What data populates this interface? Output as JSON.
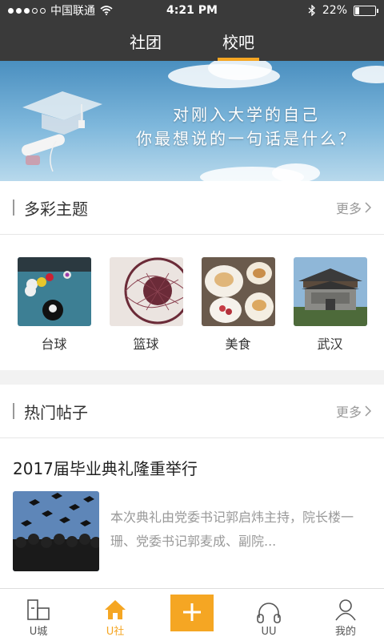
{
  "status_bar": {
    "carrier": "中国联通",
    "time": "4:21 PM",
    "battery": "22%",
    "battery_level": 0.22
  },
  "header": {
    "tabs": [
      {
        "label": "社团",
        "active": false
      },
      {
        "label": "校吧",
        "active": true
      }
    ]
  },
  "banner": {
    "line1": "对刚入大学的自己",
    "line2": "你最想说的一句话是什么？"
  },
  "topics_section": {
    "title": "多彩主题",
    "more": "更多",
    "items": [
      {
        "label": "台球",
        "icon": "billiards-image"
      },
      {
        "label": "篮球",
        "icon": "basketball-image"
      },
      {
        "label": "美食",
        "icon": "food-image"
      },
      {
        "label": "武汉",
        "icon": "wuhan-image"
      }
    ]
  },
  "posts_section": {
    "title": "热门帖子",
    "more": "更多",
    "post": {
      "title": "2017届毕业典礼隆重举行",
      "excerpt": "本次典礼由党委书记郭启炜主持，院长楼一珊、党委书记郭麦成、副院..."
    }
  },
  "bottom_nav": {
    "items": [
      {
        "label": "U城",
        "icon": "city-icon"
      },
      {
        "label": "U社",
        "icon": "home-icon",
        "active": true
      },
      {
        "label": "",
        "icon": "plus-icon"
      },
      {
        "label": "UU",
        "icon": "headphones-icon"
      },
      {
        "label": "我的",
        "icon": "user-icon"
      }
    ]
  },
  "colors": {
    "accent": "#f5a623",
    "header_bg": "#3a3a3a"
  }
}
